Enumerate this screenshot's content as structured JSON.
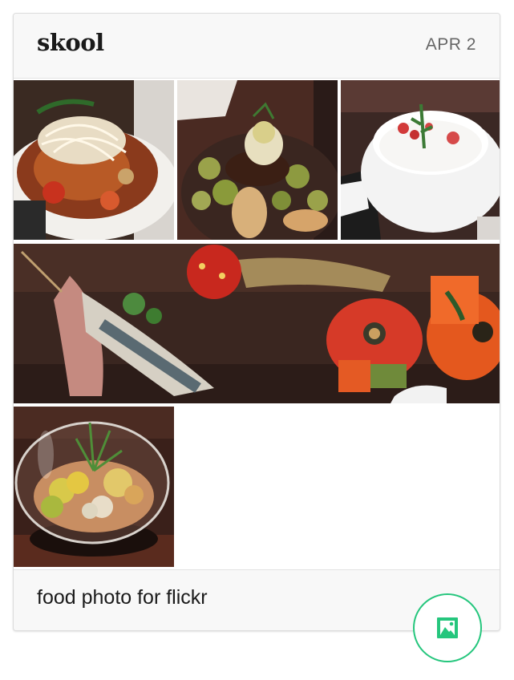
{
  "post": {
    "author": "skool",
    "date": "APR 2",
    "caption": "food photo for flickr"
  },
  "photos": [
    {
      "subject": "noodle bowl with shredded vegetables"
    },
    {
      "subject": "plated brussels sprouts and potatoes"
    },
    {
      "subject": "white dessert with berries in bowl"
    },
    {
      "subject": "fish with strawberry skewers"
    },
    {
      "subject": "glass terrarium bowl dish"
    }
  ],
  "fab": {
    "icon": "image-icon",
    "color": "#25c67d"
  }
}
